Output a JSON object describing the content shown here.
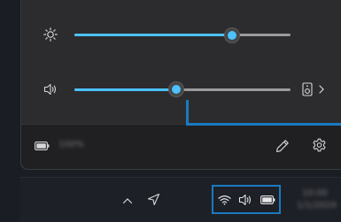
{
  "quick_settings": {
    "brightness": {
      "icon": "brightness-sun-icon",
      "level": 0.73
    },
    "volume": {
      "icon": "speaker-volume-icon",
      "level": 0.47,
      "output_icon": "audio-output-device-icon",
      "expand_icon": "chevron-right-icon"
    },
    "footer": {
      "battery_icon": "battery-icon",
      "battery_text": "100%",
      "edit_icon": "pencil-edit-icon",
      "settings_icon": "gear-settings-icon"
    }
  },
  "taskbar": {
    "overflow_icon": "chevron-up-icon",
    "location_icon": "location-arrow-icon",
    "tray_icons": [
      "wifi-icon",
      "speaker-icon",
      "battery-icon"
    ],
    "clock": {
      "time": "10:00",
      "date": "1/1/2024"
    }
  },
  "colors": {
    "accent": "#4cc2ff",
    "highlight": "#1a7ac0",
    "panel": "#2c2c2f",
    "footer": "#202023",
    "taskbar": "#1e2027"
  }
}
